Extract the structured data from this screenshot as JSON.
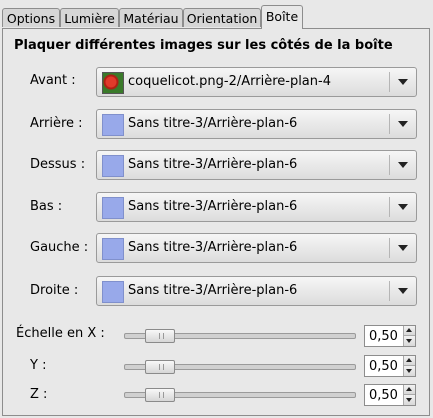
{
  "tabs": [
    {
      "label": "Options",
      "active": false
    },
    {
      "label": "Lumière",
      "active": false
    },
    {
      "label": "Matériau",
      "active": false
    },
    {
      "label": "Orientation",
      "active": false
    },
    {
      "label": "Boîte",
      "active": true
    }
  ],
  "heading": "Plaquer différentes images sur les côtés de la boîte",
  "faces": [
    {
      "label": "Avant :",
      "value": "coquelicot.png-2/Arrière-plan-4",
      "icon": "poppy-thumbnail-icon"
    },
    {
      "label": "Arrière :",
      "value": "Sans titre-3/Arrière-plan-6",
      "icon": "blue-swatch-icon"
    },
    {
      "label": "Dessus :",
      "value": "Sans titre-3/Arrière-plan-6",
      "icon": "blue-swatch-icon"
    },
    {
      "label": "Bas :",
      "value": "Sans titre-3/Arrière-plan-6",
      "icon": "blue-swatch-icon"
    },
    {
      "label": "Gauche :",
      "value": "Sans titre-3/Arrière-plan-6",
      "icon": "blue-swatch-icon"
    },
    {
      "label": "Droite :",
      "value": "Sans titre-3/Arrière-plan-6",
      "icon": "blue-swatch-icon"
    }
  ],
  "scale": {
    "x": {
      "label": "Échelle en X :",
      "value": "0,50",
      "level": 0.5
    },
    "y": {
      "label": "Y :",
      "value": "0,50",
      "level": 0.5
    },
    "z": {
      "label": "Z :",
      "value": "0,50",
      "level": 0.5
    }
  },
  "colors": {
    "swatch": "#98a9ea",
    "background": "#e8e8e8"
  }
}
